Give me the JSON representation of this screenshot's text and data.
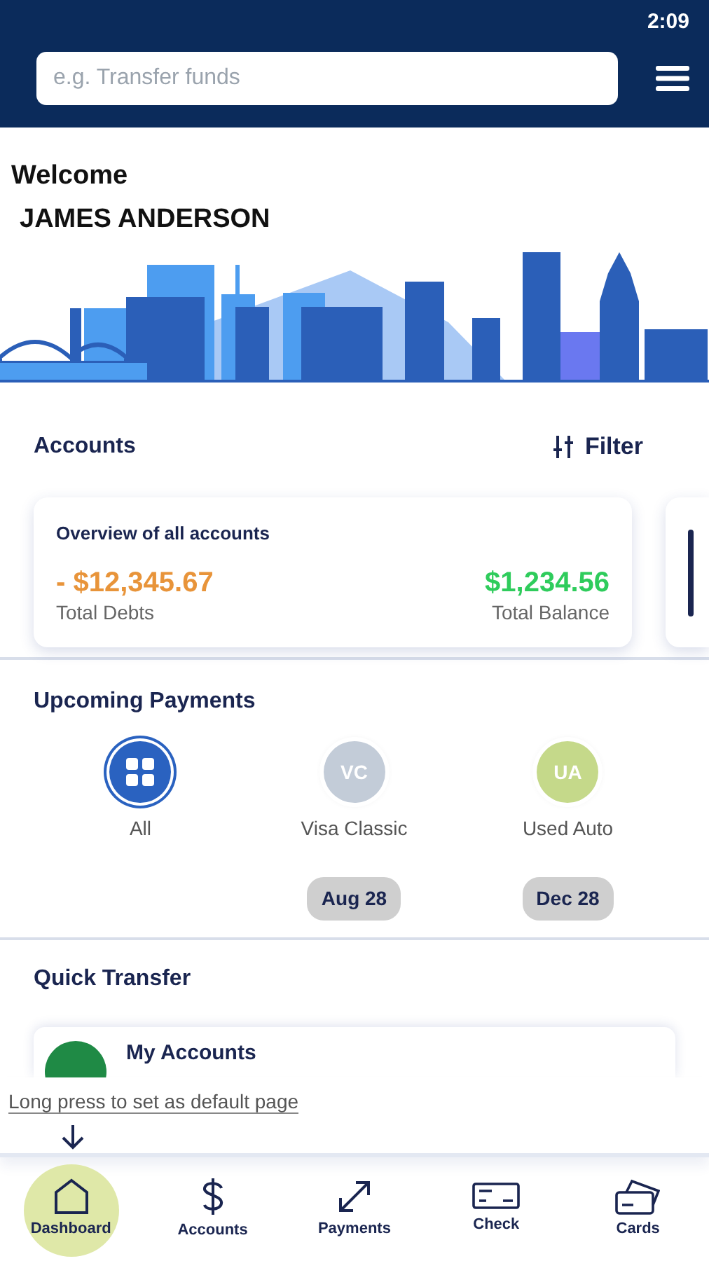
{
  "status_bar": {
    "time": "2:09"
  },
  "search": {
    "placeholder": "e.g. Transfer funds"
  },
  "welcome": {
    "greeting": "Welcome",
    "name": "JAMES ANDERSON"
  },
  "accounts": {
    "title": "Accounts",
    "filter_label": "Filter",
    "overview": {
      "title": "Overview of all accounts",
      "debts_amount": "- $12,345.67",
      "debts_label": "Total Debts",
      "balance_amount": "$1,234.56",
      "balance_label": "Total Balance"
    }
  },
  "upcoming_payments": {
    "title": "Upcoming Payments",
    "items": [
      {
        "kind": "all",
        "label": "All",
        "selected": true
      },
      {
        "kind": "account",
        "initials": "VC",
        "label": "Visa Classic",
        "color": "#c3ccd8",
        "date": "Aug 28",
        "selected": false
      },
      {
        "kind": "account",
        "initials": "UA",
        "label": "Used Auto",
        "color": "#c5d98a",
        "date": "Dec 28",
        "selected": false
      }
    ]
  },
  "quick_transfer": {
    "title": "Quick Transfer",
    "items": [
      {
        "title": "My Accounts",
        "color": "#1f8a45"
      }
    ]
  },
  "hint": "Long press to set as default page",
  "nav": [
    {
      "kind": "home",
      "label": "Dashboard",
      "selected": true
    },
    {
      "kind": "dollar",
      "label": "Accounts",
      "selected": false
    },
    {
      "kind": "arrows",
      "label": "Payments",
      "selected": false
    },
    {
      "kind": "check",
      "label": "Check",
      "selected": false
    },
    {
      "kind": "cards",
      "label": "Cards",
      "selected": false
    }
  ]
}
